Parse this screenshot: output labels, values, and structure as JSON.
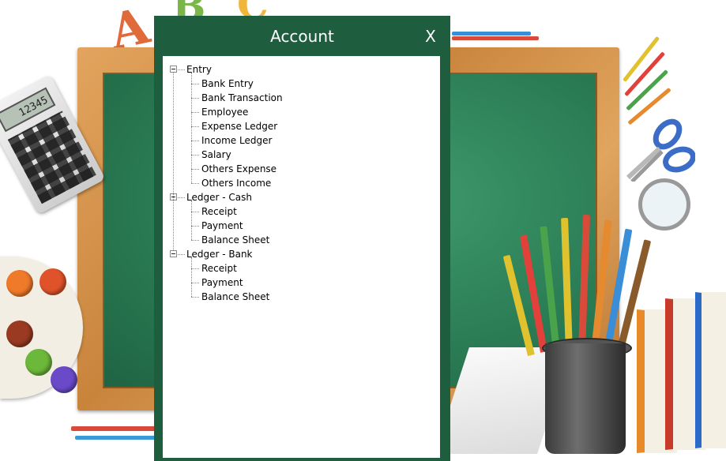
{
  "dialog": {
    "title": "Account",
    "close_label": "X",
    "background_color": "#1e5e3e"
  },
  "tree": {
    "groups": [
      {
        "label": "Entry",
        "items": [
          "Bank Entry",
          "Bank Transaction",
          "Employee",
          "Expense Ledger",
          "Income Ledger",
          "Salary",
          "Others Expense",
          "Others Income"
        ]
      },
      {
        "label": "Ledger - Cash",
        "items": [
          "Receipt",
          "Payment",
          "Balance Sheet"
        ]
      },
      {
        "label": "Ledger - Bank",
        "items": [
          "Receipt",
          "Payment",
          "Balance Sheet"
        ]
      }
    ]
  },
  "background": {
    "calculator_display": "12345",
    "letters": [
      "A",
      "B",
      "C"
    ]
  }
}
